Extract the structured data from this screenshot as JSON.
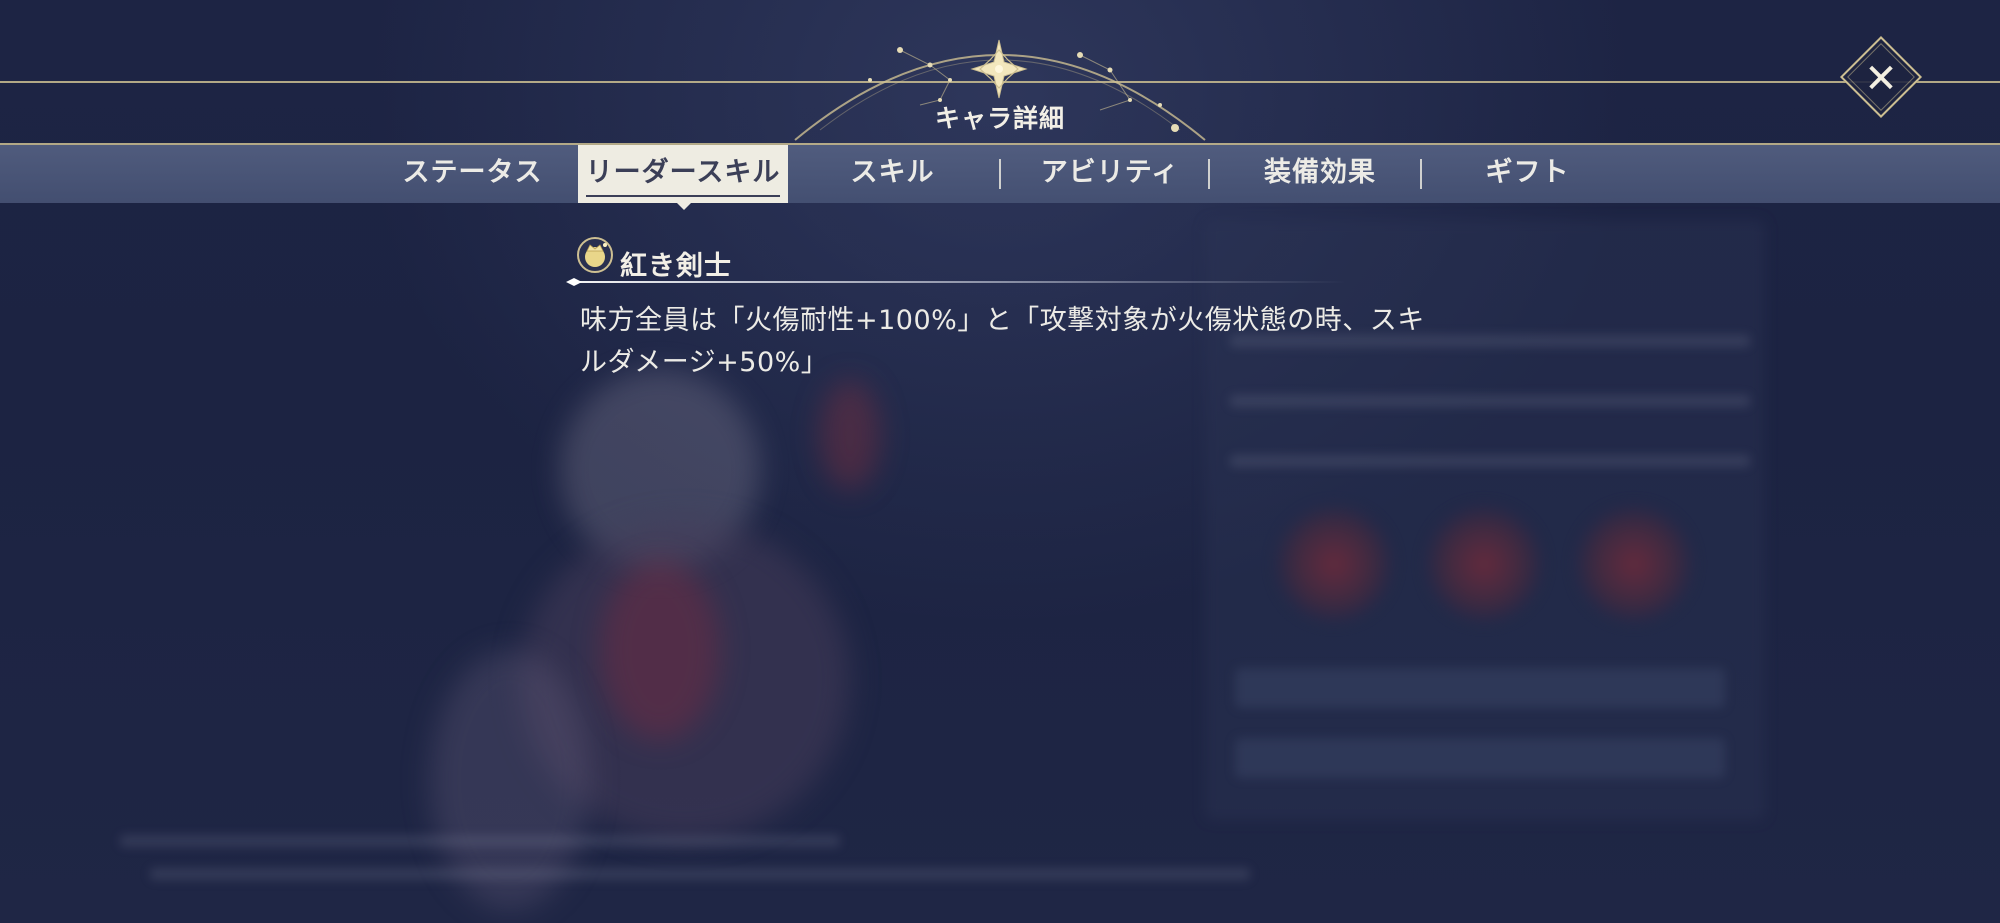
{
  "header": {
    "title": "キャラ詳細"
  },
  "tabs": [
    {
      "label": "ステータス",
      "active": false
    },
    {
      "label": "リーダースキル",
      "active": true
    },
    {
      "label": "スキル",
      "active": false
    },
    {
      "label": "アビリティ",
      "active": false
    },
    {
      "label": "装備効果",
      "active": false
    },
    {
      "label": "ギフト",
      "active": false
    }
  ],
  "leader_skill": {
    "name": "紅き剣士",
    "description": "味方全員は「火傷耐性+100%」と「攻撃対象が火傷状態の時、スキルダメージ+50%」",
    "icon": "crown-badge-icon"
  },
  "icons": {
    "close": "close-icon",
    "header_emblem": "compass-star-icon"
  },
  "colors": {
    "gold": "#cdbf92",
    "background": "#1b2240",
    "tab_bar": "#56627f",
    "active_tab": "#eeece2",
    "text": "#ecebe6"
  }
}
